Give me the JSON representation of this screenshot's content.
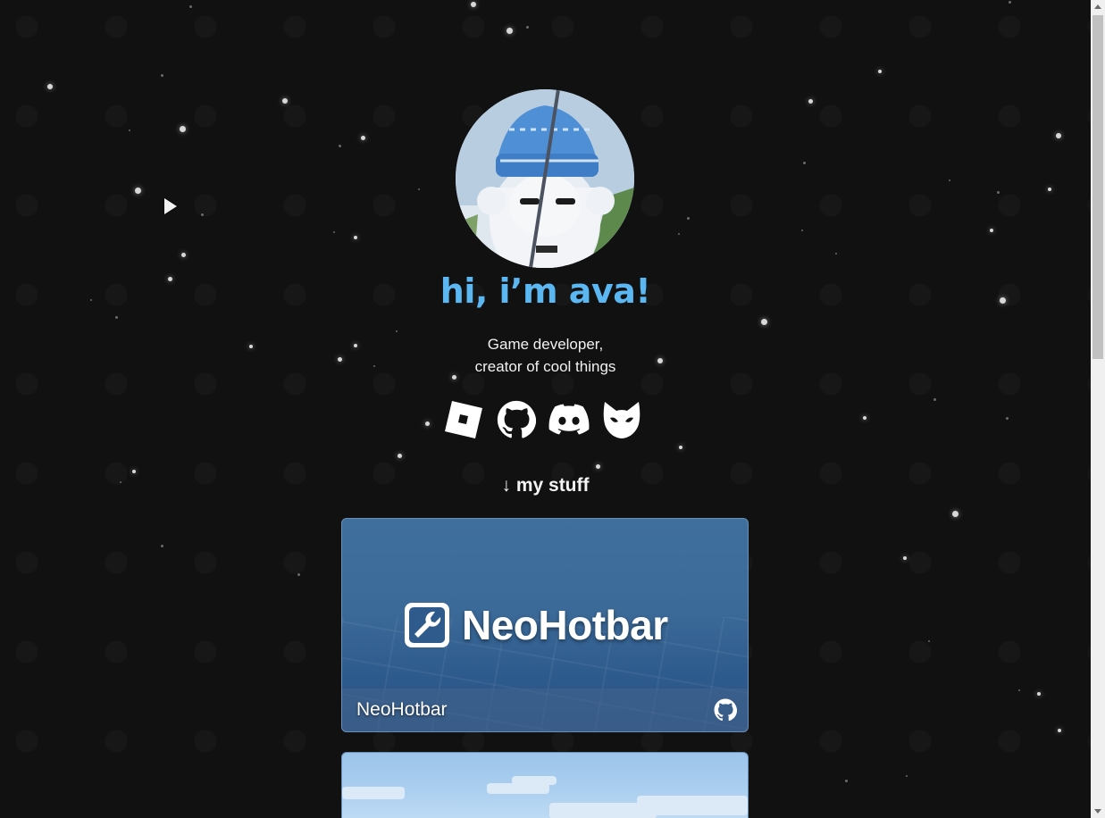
{
  "hero": {
    "title": "hi, i’m ava!",
    "subtitle_line1": "Game developer,",
    "subtitle_line2": "creator of cool things"
  },
  "socials": [
    {
      "icon": "roblox-icon"
    },
    {
      "icon": "github-icon"
    },
    {
      "icon": "discord-icon"
    },
    {
      "icon": "fox-mask-icon"
    }
  ],
  "section": {
    "label": "my stuff",
    "arrow": "↓"
  },
  "projects": [
    {
      "name": "NeoHotbar",
      "logo_text": "NeoHotbar",
      "link_icon": "github-icon"
    },
    {
      "name": "",
      "logo_text": ""
    }
  ],
  "colors": {
    "background": "#111112",
    "title_accent": "#5bb7f2",
    "card_blue": "#3d6b99"
  }
}
